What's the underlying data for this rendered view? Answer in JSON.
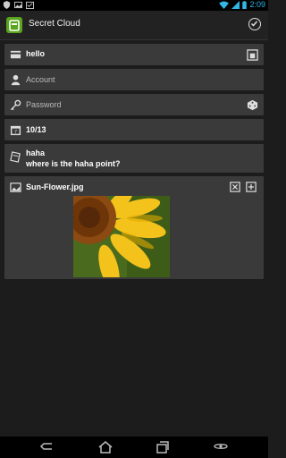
{
  "status": {
    "time": "2:09"
  },
  "app": {
    "title": "Secret Cloud"
  },
  "fields": {
    "title_value": "hello",
    "account_placeholder": "Account",
    "password_placeholder": "Password",
    "date_value": "10/13",
    "note_title": "haha",
    "note_body": "where is the haha point?",
    "attachment_name": "Sun-Flower.jpg"
  },
  "icons": {
    "status_left": [
      "shield-check-icon",
      "image-icon",
      "calendar-check-icon"
    ],
    "status_right": [
      "wifi-icon",
      "signal-icon",
      "battery-icon"
    ],
    "actionbar": [
      "app-logo-icon",
      "done-check-icon"
    ],
    "fields": [
      "card-icon",
      "person-icon",
      "key-icon",
      "calendar-icon",
      "note-icon",
      "image-icon",
      "preview-icon",
      "dice-icon",
      "delete-icon",
      "add-icon"
    ],
    "navigation": [
      "back-icon",
      "home-icon",
      "recents-icon",
      "menu-icon"
    ]
  },
  "colors": {
    "accent": "#33b5e5",
    "brand": "#5aa51d",
    "field_bg": "#3a3a3a"
  }
}
